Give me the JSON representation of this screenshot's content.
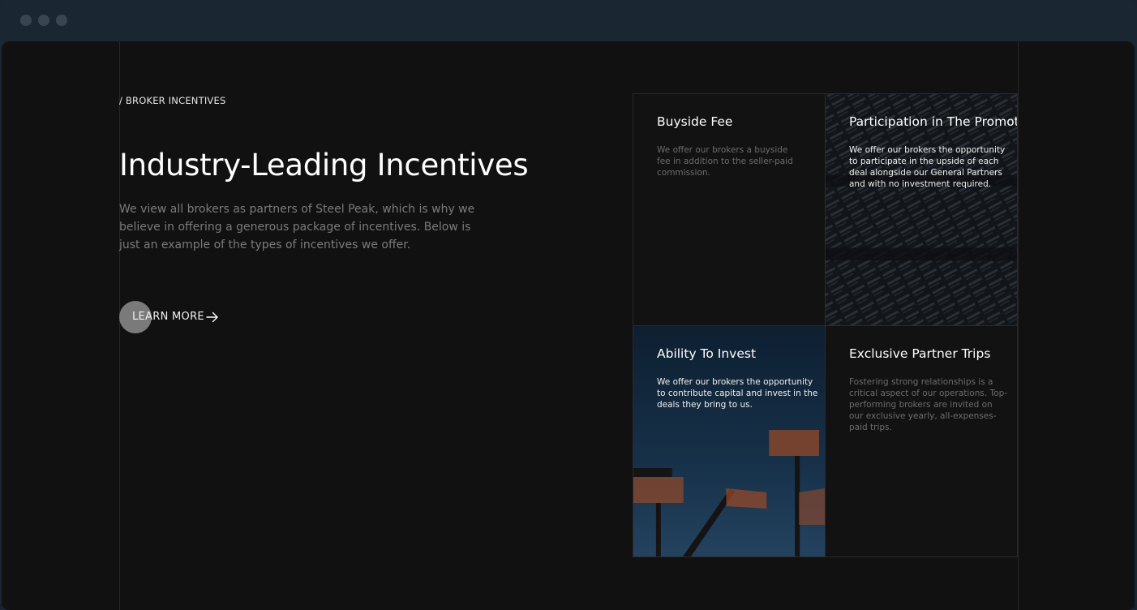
{
  "section": {
    "eyebrow": "/ BROKER INCENTIVES",
    "headline": "Industry-Leading Incentives",
    "intro": "We view all brokers as partners of Steel Peak, which is why we believe in offering a generous package of incentives. Below is just an example of the types of incentives we offer.",
    "cta_label": "LEARN MORE"
  },
  "cards": [
    {
      "title": "Buyside Fee",
      "text": "We offer our brokers a buyside fee in addition to the seller-paid commission."
    },
    {
      "title": "Participation in The Promote",
      "text": "We offer our brokers the opportunity to participate in the upside of each deal alongside our General Partners and with no investment required."
    },
    {
      "title": "Ability To Invest",
      "text": "We offer our brokers the opportunity to contribute capital and invest in the deals they bring to us."
    },
    {
      "title": "Exclusive Partner Trips",
      "text": "Fostering strong relationships is a critical aspect of our operations. Top-performing brokers are invited on our exclusive yearly, all-expenses-paid trips."
    }
  ],
  "icons": {
    "cta_arrow": "arrow-right-icon",
    "window_controls": [
      "close",
      "minimize",
      "maximize"
    ]
  },
  "colors": {
    "page_background": "#111111",
    "window_chrome": "#1b2633",
    "cta_circle": "#7a7a7a"
  }
}
